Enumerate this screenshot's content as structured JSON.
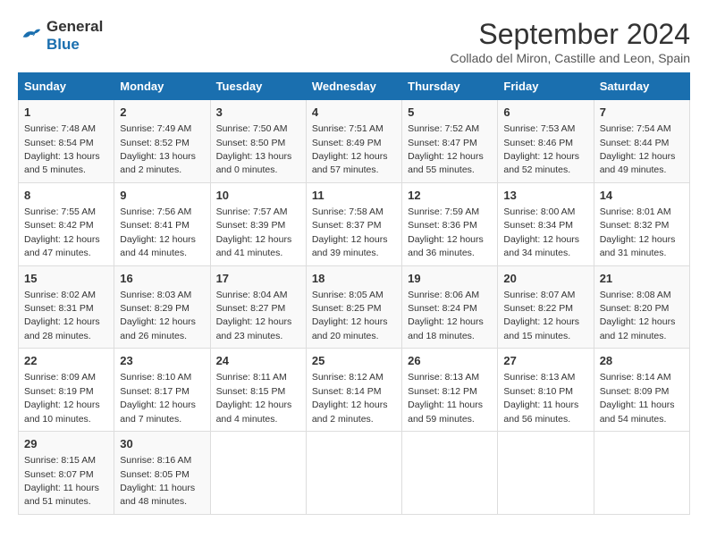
{
  "logo": {
    "line1": "General",
    "line2": "Blue"
  },
  "title": "September 2024",
  "subtitle": "Collado del Miron, Castille and Leon, Spain",
  "days_of_week": [
    "Sunday",
    "Monday",
    "Tuesday",
    "Wednesday",
    "Thursday",
    "Friday",
    "Saturday"
  ],
  "weeks": [
    [
      {
        "day": "1",
        "sunrise": "7:48 AM",
        "sunset": "8:54 PM",
        "daylight": "13 hours and 5 minutes."
      },
      {
        "day": "2",
        "sunrise": "7:49 AM",
        "sunset": "8:52 PM",
        "daylight": "13 hours and 2 minutes."
      },
      {
        "day": "3",
        "sunrise": "7:50 AM",
        "sunset": "8:50 PM",
        "daylight": "13 hours and 0 minutes."
      },
      {
        "day": "4",
        "sunrise": "7:51 AM",
        "sunset": "8:49 PM",
        "daylight": "12 hours and 57 minutes."
      },
      {
        "day": "5",
        "sunrise": "7:52 AM",
        "sunset": "8:47 PM",
        "daylight": "12 hours and 55 minutes."
      },
      {
        "day": "6",
        "sunrise": "7:53 AM",
        "sunset": "8:46 PM",
        "daylight": "12 hours and 52 minutes."
      },
      {
        "day": "7",
        "sunrise": "7:54 AM",
        "sunset": "8:44 PM",
        "daylight": "12 hours and 49 minutes."
      }
    ],
    [
      {
        "day": "8",
        "sunrise": "7:55 AM",
        "sunset": "8:42 PM",
        "daylight": "12 hours and 47 minutes."
      },
      {
        "day": "9",
        "sunrise": "7:56 AM",
        "sunset": "8:41 PM",
        "daylight": "12 hours and 44 minutes."
      },
      {
        "day": "10",
        "sunrise": "7:57 AM",
        "sunset": "8:39 PM",
        "daylight": "12 hours and 41 minutes."
      },
      {
        "day": "11",
        "sunrise": "7:58 AM",
        "sunset": "8:37 PM",
        "daylight": "12 hours and 39 minutes."
      },
      {
        "day": "12",
        "sunrise": "7:59 AM",
        "sunset": "8:36 PM",
        "daylight": "12 hours and 36 minutes."
      },
      {
        "day": "13",
        "sunrise": "8:00 AM",
        "sunset": "8:34 PM",
        "daylight": "12 hours and 34 minutes."
      },
      {
        "day": "14",
        "sunrise": "8:01 AM",
        "sunset": "8:32 PM",
        "daylight": "12 hours and 31 minutes."
      }
    ],
    [
      {
        "day": "15",
        "sunrise": "8:02 AM",
        "sunset": "8:31 PM",
        "daylight": "12 hours and 28 minutes."
      },
      {
        "day": "16",
        "sunrise": "8:03 AM",
        "sunset": "8:29 PM",
        "daylight": "12 hours and 26 minutes."
      },
      {
        "day": "17",
        "sunrise": "8:04 AM",
        "sunset": "8:27 PM",
        "daylight": "12 hours and 23 minutes."
      },
      {
        "day": "18",
        "sunrise": "8:05 AM",
        "sunset": "8:25 PM",
        "daylight": "12 hours and 20 minutes."
      },
      {
        "day": "19",
        "sunrise": "8:06 AM",
        "sunset": "8:24 PM",
        "daylight": "12 hours and 18 minutes."
      },
      {
        "day": "20",
        "sunrise": "8:07 AM",
        "sunset": "8:22 PM",
        "daylight": "12 hours and 15 minutes."
      },
      {
        "day": "21",
        "sunrise": "8:08 AM",
        "sunset": "8:20 PM",
        "daylight": "12 hours and 12 minutes."
      }
    ],
    [
      {
        "day": "22",
        "sunrise": "8:09 AM",
        "sunset": "8:19 PM",
        "daylight": "12 hours and 10 minutes."
      },
      {
        "day": "23",
        "sunrise": "8:10 AM",
        "sunset": "8:17 PM",
        "daylight": "12 hours and 7 minutes."
      },
      {
        "day": "24",
        "sunrise": "8:11 AM",
        "sunset": "8:15 PM",
        "daylight": "12 hours and 4 minutes."
      },
      {
        "day": "25",
        "sunrise": "8:12 AM",
        "sunset": "8:14 PM",
        "daylight": "12 hours and 2 minutes."
      },
      {
        "day": "26",
        "sunrise": "8:13 AM",
        "sunset": "8:12 PM",
        "daylight": "11 hours and 59 minutes."
      },
      {
        "day": "27",
        "sunrise": "8:13 AM",
        "sunset": "8:10 PM",
        "daylight": "11 hours and 56 minutes."
      },
      {
        "day": "28",
        "sunrise": "8:14 AM",
        "sunset": "8:09 PM",
        "daylight": "11 hours and 54 minutes."
      }
    ],
    [
      {
        "day": "29",
        "sunrise": "8:15 AM",
        "sunset": "8:07 PM",
        "daylight": "11 hours and 51 minutes."
      },
      {
        "day": "30",
        "sunrise": "8:16 AM",
        "sunset": "8:05 PM",
        "daylight": "11 hours and 48 minutes."
      },
      null,
      null,
      null,
      null,
      null
    ]
  ],
  "labels": {
    "sunrise": "Sunrise:",
    "sunset": "Sunset:",
    "daylight": "Daylight:"
  }
}
